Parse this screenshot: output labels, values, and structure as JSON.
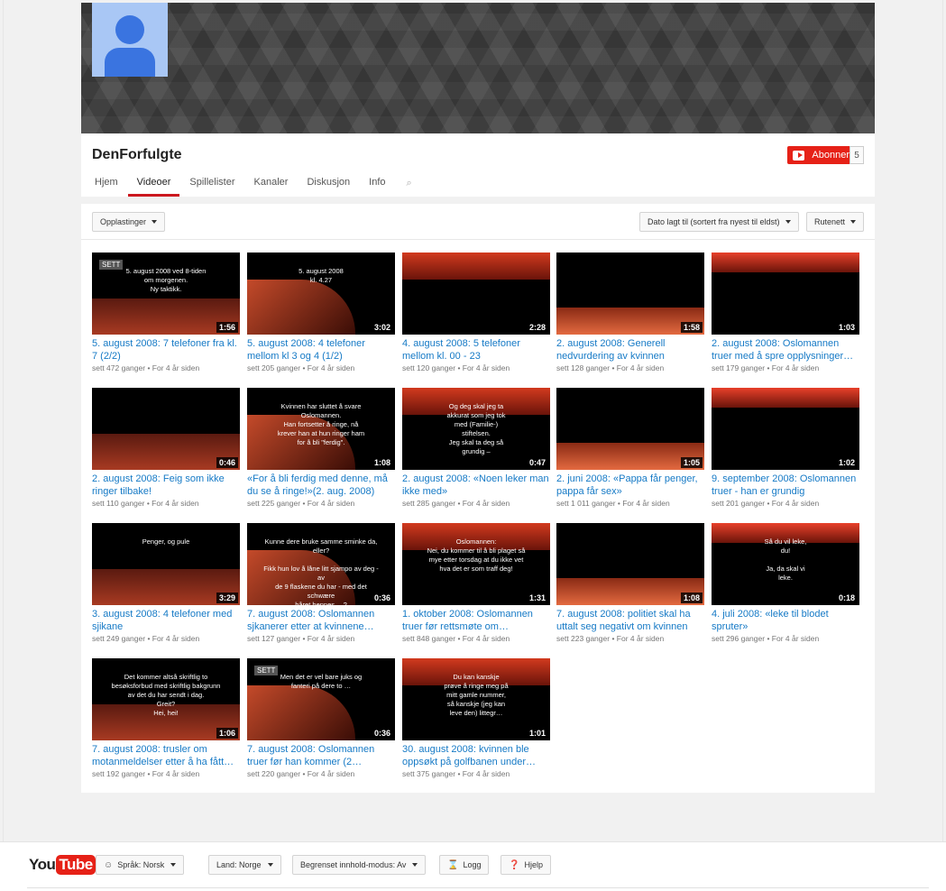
{
  "channel": {
    "name": "DenForfulgte",
    "subscribe_label": "Abonner",
    "subscriber_count": "5"
  },
  "tabs": [
    {
      "label": "Hjem",
      "active": false
    },
    {
      "label": "Videoer",
      "active": true
    },
    {
      "label": "Spillelister",
      "active": false
    },
    {
      "label": "Kanaler",
      "active": false
    },
    {
      "label": "Diskusjon",
      "active": false
    },
    {
      "label": "Info",
      "active": false
    }
  ],
  "toolbar": {
    "uploads_label": "Opplastinger",
    "sort_label": "Dato lagt til (sortert fra nyest til eldst)",
    "view_label": "Rutenett"
  },
  "videos": [
    {
      "title": "5. august 2008: 7 telefoner fra kl. 7 (2/2)",
      "views": "sett 472 ganger",
      "age": "For 4 år siden",
      "duration": "1:56",
      "badge": "SETT",
      "overlay": "5. august 2008 ved 8-tiden\nom morgenen.\nNy taktikk."
    },
    {
      "title": "5. august 2008: 4 telefoner mellom kl 3 og 4 (1/2)",
      "views": "sett 205 ganger",
      "age": "For 4 år siden",
      "duration": "3:02",
      "overlay": "5. august 2008\nkl. 4.27"
    },
    {
      "title": "4. august 2008: 5 telefoner mellom kl. 00 - 23",
      "views": "sett 120 ganger",
      "age": "For 4 år siden",
      "duration": "2:28"
    },
    {
      "title": "2. august 2008: Generell nedvurdering av kvinnen",
      "views": "sett 128 ganger",
      "age": "For 4 år siden",
      "duration": "1:58"
    },
    {
      "title": "2. august 2008: Oslomannen truer med å spre opplysninger…",
      "views": "sett 179 ganger",
      "age": "For 4 år siden",
      "duration": "1:03"
    },
    {
      "title": "2. august 2008: Feig som ikke ringer tilbake!",
      "views": "sett 110 ganger",
      "age": "For 4 år siden",
      "duration": "0:46"
    },
    {
      "title": "«For å bli ferdig med denne, må du se å ringe!»(2. aug. 2008)",
      "views": "sett 225 ganger",
      "age": "For 4 år siden",
      "duration": "1:08",
      "overlay": "Kvinnen har sluttet å svare\nOslomannen.\nHan fortsetter å ringe, nå\nkrever han at hun ringer ham\nfor å bli \"ferdig\"."
    },
    {
      "title": "2. august 2008: «Noen leker man ikke med»",
      "views": "sett 285 ganger",
      "age": "For 4 år siden",
      "duration": "0:47",
      "overlay": "Og deg skal jeg ta\nakkurat som jeg tok\nmed (Familie-)\nstiftelsen.\nJeg skal ta deg så\ngrundig –"
    },
    {
      "title": "2. juni 2008: «Pappa får penger, pappa får sex»",
      "views": "sett 1 011 ganger",
      "age": "For 4 år siden",
      "duration": "1:05"
    },
    {
      "title": "9. september 2008: Oslomannen truer - han er grundig",
      "views": "sett 201 ganger",
      "age": "For 4 år siden",
      "duration": "1:02"
    },
    {
      "title": "3. august 2008: 4 telefoner med sjikane",
      "views": "sett 249 ganger",
      "age": "For 4 år siden",
      "duration": "3:29",
      "overlay": "Penger, og pule"
    },
    {
      "title": "7. august 2008: Oslomannen sjkanerer etter at kvinnene…",
      "views": "sett 127 ganger",
      "age": "For 4 år siden",
      "duration": "0:36",
      "overlay": "Kunne dere bruke samme sminke da,\neller?\n\nFikk hun lov å låne litt sjampo av deg - av\nde 9 flaskene du har - med det schwære\nhåret hennes …?"
    },
    {
      "title": "1. oktober 2008: Oslomannen truer før rettsmøte om…",
      "views": "sett 848 ganger",
      "age": "For 4 år siden",
      "duration": "1:31",
      "overlay": "Oslomannen:\nNei, du kommer til å bli plaget så\nmye etter torsdag at du ikke vet\nhva det er som traff deg!"
    },
    {
      "title": "7. august 2008: politiet skal ha uttalt seg negativt om kvinnen",
      "views": "sett 223 ganger",
      "age": "For 4 år siden",
      "duration": "1:08"
    },
    {
      "title": "4. juli 2008: «leke til blodet spruter»",
      "views": "sett 296 ganger",
      "age": "For 4 år siden",
      "duration": "0:18",
      "overlay": "Så du vil leke,\ndu!\n\nJa, da skal vi\nleke."
    },
    {
      "title": "7. august 2008: trusler om motanmeldelser etter å ha fått…",
      "views": "sett 192 ganger",
      "age": "For 4 år siden",
      "duration": "1:06",
      "overlay": "Det kommer altså skriftlig to\nbesøksforbud med skriftlig bakgrunn\nav det du har sendt i dag.\nGreit?\nHei, hei!"
    },
    {
      "title": "7. august 2008: Oslomannen truer før han kommer (2…",
      "views": "sett 220 ganger",
      "age": "For 4 år siden",
      "duration": "0:36",
      "badge": "SETT",
      "overlay": "Men det er vel bare juks og\nfanteri på dere to …"
    },
    {
      "title": "30. august 2008: kvinnen ble oppsøkt på golfbanen under…",
      "views": "sett 375 ganger",
      "age": "For 4 år siden",
      "duration": "1:01",
      "overlay": "Du kan kanskje\nprøve å ringe meg på\nmitt gamle nummer,\nså kanskje (jeg kan\nleve den) littegr…"
    }
  ],
  "footer": {
    "logo_you": "You",
    "logo_tube": "Tube",
    "language_label": "Språk: Norsk",
    "country_label": "Land: Norge",
    "restricted_label": "Begrenset innhold-modus: Av",
    "history_label": "Logg",
    "help_label": "Hjelp"
  },
  "colors": {
    "link": "#167ac6",
    "accent": "#e62117",
    "active_tab": "#cc181e"
  }
}
